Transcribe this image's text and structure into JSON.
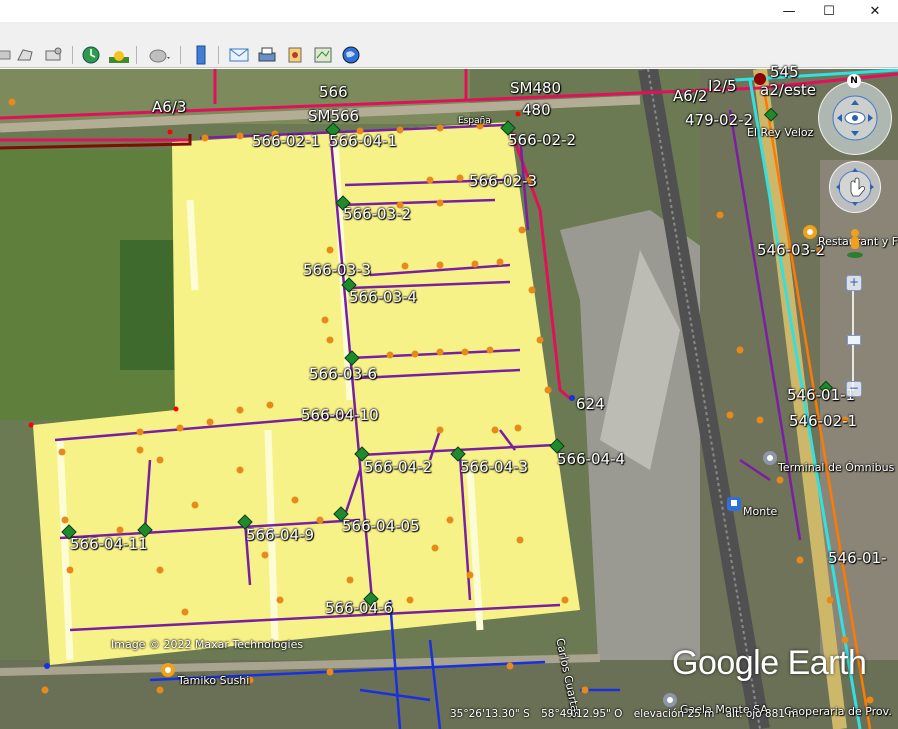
{
  "window": {
    "buttons": [
      {
        "name": "minimize-button",
        "glyph": "—"
      },
      {
        "name": "maximize-button",
        "glyph": "☐"
      },
      {
        "name": "close-button",
        "glyph": "✕"
      }
    ]
  },
  "toolbar": {
    "tools": [
      {
        "name": "placemark-tool",
        "icon": "pushpin-icon"
      },
      {
        "name": "polygon-tool",
        "icon": "polygon-icon"
      },
      {
        "name": "path-tool",
        "icon": "path-icon"
      },
      {
        "name": "historical-imagery-tool",
        "icon": "clock-icon"
      },
      {
        "name": "sunlight-tool",
        "icon": "sun-icon"
      },
      {
        "name": "planet-switch-tool",
        "icon": "planet-icon"
      },
      {
        "name": "ruler-tool",
        "icon": "ruler-icon"
      },
      {
        "name": "email-tool",
        "icon": "envelope-icon"
      },
      {
        "name": "print-tool",
        "icon": "printer-icon"
      },
      {
        "name": "save-image-tool",
        "icon": "save-image-icon"
      },
      {
        "name": "view-in-maps-tool",
        "icon": "map-icon"
      },
      {
        "name": "earth-gallery-tool",
        "icon": "globe-icon"
      }
    ]
  },
  "map": {
    "labels": [
      {
        "id": "l1",
        "text": "566",
        "size": "md"
      },
      {
        "id": "l2",
        "text": "SM480",
        "size": "md"
      },
      {
        "id": "l3",
        "text": "A6/3",
        "size": "md"
      },
      {
        "id": "l4",
        "text": "SM566",
        "size": "md"
      },
      {
        "id": "l5",
        "text": "480",
        "size": "md"
      },
      {
        "id": "l6",
        "text": "España",
        "size": "xs"
      },
      {
        "id": "l7",
        "text": "A6/2",
        "size": "md"
      },
      {
        "id": "l8",
        "text": "I2/5",
        "size": "md"
      },
      {
        "id": "l9",
        "text": "545",
        "size": "md"
      },
      {
        "id": "l10",
        "text": "a2/este",
        "size": "md"
      },
      {
        "id": "l11",
        "text": "479-02-2",
        "size": "md"
      },
      {
        "id": "l12",
        "text": "El Rey Veloz",
        "size": "sm"
      },
      {
        "id": "l13",
        "text": "566-02-1",
        "size": "md"
      },
      {
        "id": "l14",
        "text": "566-04-1",
        "size": "md"
      },
      {
        "id": "l15",
        "text": "566-02-2",
        "size": "md"
      },
      {
        "id": "l16",
        "text": "566-02-3",
        "size": "md"
      },
      {
        "id": "l17",
        "text": "566-03-2",
        "size": "md"
      },
      {
        "id": "l18",
        "text": "546-03-2",
        "size": "md"
      },
      {
        "id": "l19",
        "text": "Restaurant y F",
        "size": "sm"
      },
      {
        "id": "l20",
        "text": "566-03-3",
        "size": "md"
      },
      {
        "id": "l21",
        "text": "566-03-4",
        "size": "md"
      },
      {
        "id": "l22",
        "text": "566-03-6",
        "size": "md"
      },
      {
        "id": "l23",
        "text": "624",
        "size": "md"
      },
      {
        "id": "l24",
        "text": "546-01-1",
        "size": "md"
      },
      {
        "id": "l25",
        "text": "566-04-10",
        "size": "md"
      },
      {
        "id": "l26",
        "text": "546-02-1",
        "size": "md"
      },
      {
        "id": "l27",
        "text": "566-04-2",
        "size": "md"
      },
      {
        "id": "l28",
        "text": "566-04-3",
        "size": "md"
      },
      {
        "id": "l29",
        "text": "566-04-4",
        "size": "md"
      },
      {
        "id": "l30",
        "text": "Terminal de Ómnibus",
        "size": "sm"
      },
      {
        "id": "l31",
        "text": "Monte",
        "size": "sm"
      },
      {
        "id": "l32",
        "text": "566-04-05",
        "size": "md"
      },
      {
        "id": "l33",
        "text": "566-04-11",
        "size": "md"
      },
      {
        "id": "l34",
        "text": "566-04-9",
        "size": "md"
      },
      {
        "id": "l35",
        "text": "546-01-",
        "size": "md"
      },
      {
        "id": "l36",
        "text": "566-04-6",
        "size": "md"
      },
      {
        "id": "l37",
        "text": "Carlos Cuartas",
        "size": "sm"
      },
      {
        "id": "l38",
        "text": "Tamiko Sushi",
        "size": "sm"
      },
      {
        "id": "l39",
        "text": "Gaela Monte SA",
        "size": "sm"
      },
      {
        "id": "l40",
        "text": "Cooperaria de Prov.",
        "size": "sm"
      }
    ],
    "copyright": "Image © 2022 Maxar Technologies",
    "logo": "Google Earth"
  },
  "status": {
    "lat": "35°26'13.30\" S",
    "lon": "58°49'12.95\" O",
    "elev": "elevación   25 m",
    "eye": "alt. ojo  881 m"
  },
  "colors": {
    "yellow_area": "#fff98a",
    "pink_line": "#e0105a",
    "purple_line": "#7a1fa2",
    "orange_dot": "#e88a1a",
    "green_node": "#1f8a2c",
    "cyan_line": "#32e0e0",
    "blue_line": "#1a2fe0",
    "orange_line": "#ff7a00"
  }
}
